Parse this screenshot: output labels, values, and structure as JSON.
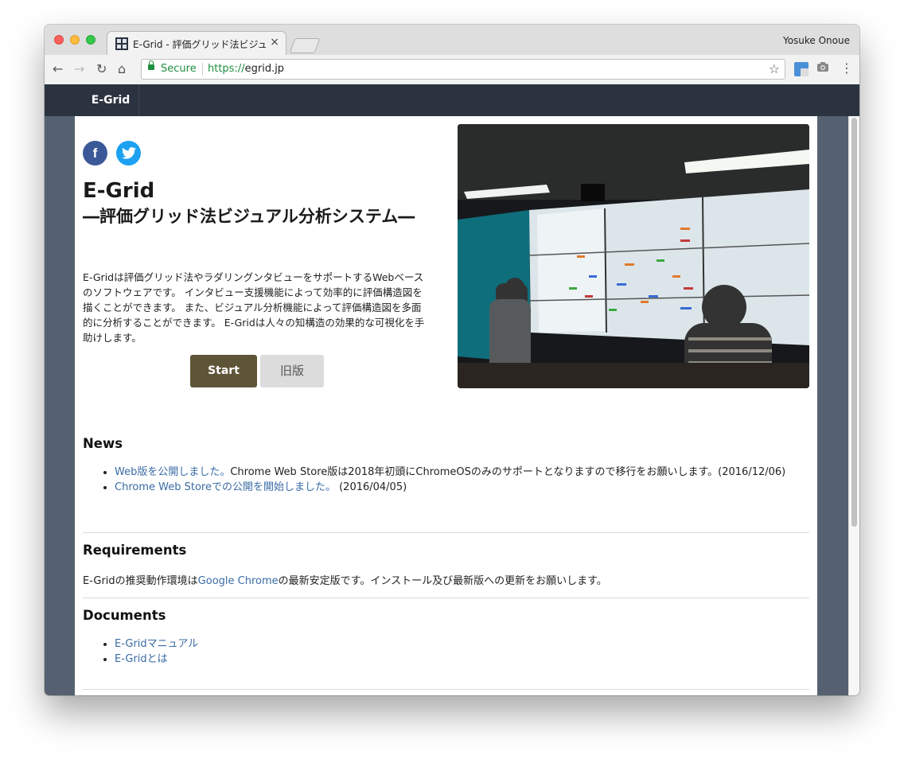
{
  "browser": {
    "tab_title": "E-Grid - 評価グリッド法ビジュ",
    "tab_close": "×",
    "profile_name": "Yosuke Onoue",
    "secure_label": "Secure",
    "url_scheme": "https://",
    "url_host": "egrid.jp",
    "icons": {
      "back": "←",
      "forward": "→",
      "reload": "↻",
      "home": "⌂",
      "star": "☆",
      "camera": "📷",
      "menu": "⋮"
    }
  },
  "site": {
    "brand": "E-Grid",
    "social": {
      "facebook": "f",
      "twitter": "🐦"
    },
    "title": "E-Grid",
    "subtitle": "―評価グリッド法ビジュアル分析システム―",
    "description": "E-Gridは評価グリッド法やラダリングンタビューをサポートするWebベースのソフトウェアです。 インタビュー支援機能によって効率的に評価構造図を描くことができます。 また、ビジュアル分析機能によって評価構造図を多面的に分析することができます。 E-Gridは人々の知構造の効果的な可視化を手助けします。",
    "buttons": {
      "start": "Start",
      "old": "旧版"
    }
  },
  "news": {
    "heading": "News",
    "items": [
      {
        "link": "Web版を公開しました。",
        "text": "Chrome Web Store版は2018年初頭にChromeOSのみのサポートとなりますので移行をお願いします。(2016/12/06)"
      },
      {
        "link": "Chrome Web Storeでの公開を開始しました。",
        "text": " (2016/04/05)"
      }
    ]
  },
  "requirements": {
    "heading": "Requirements",
    "before": "E-Gridの推奨動作環境は",
    "link": "Google Chrome",
    "after": "の最新安定版です。インストール及び最新版への更新をお願いします。"
  },
  "documents": {
    "heading": "Documents",
    "items": [
      "E-Gridマニュアル",
      "E-Gridとは"
    ]
  },
  "colors": {
    "navbar": "#2c3340",
    "start_button": "#5e5437",
    "link": "#3a6ba5",
    "secure_green": "#1e8e3e"
  }
}
